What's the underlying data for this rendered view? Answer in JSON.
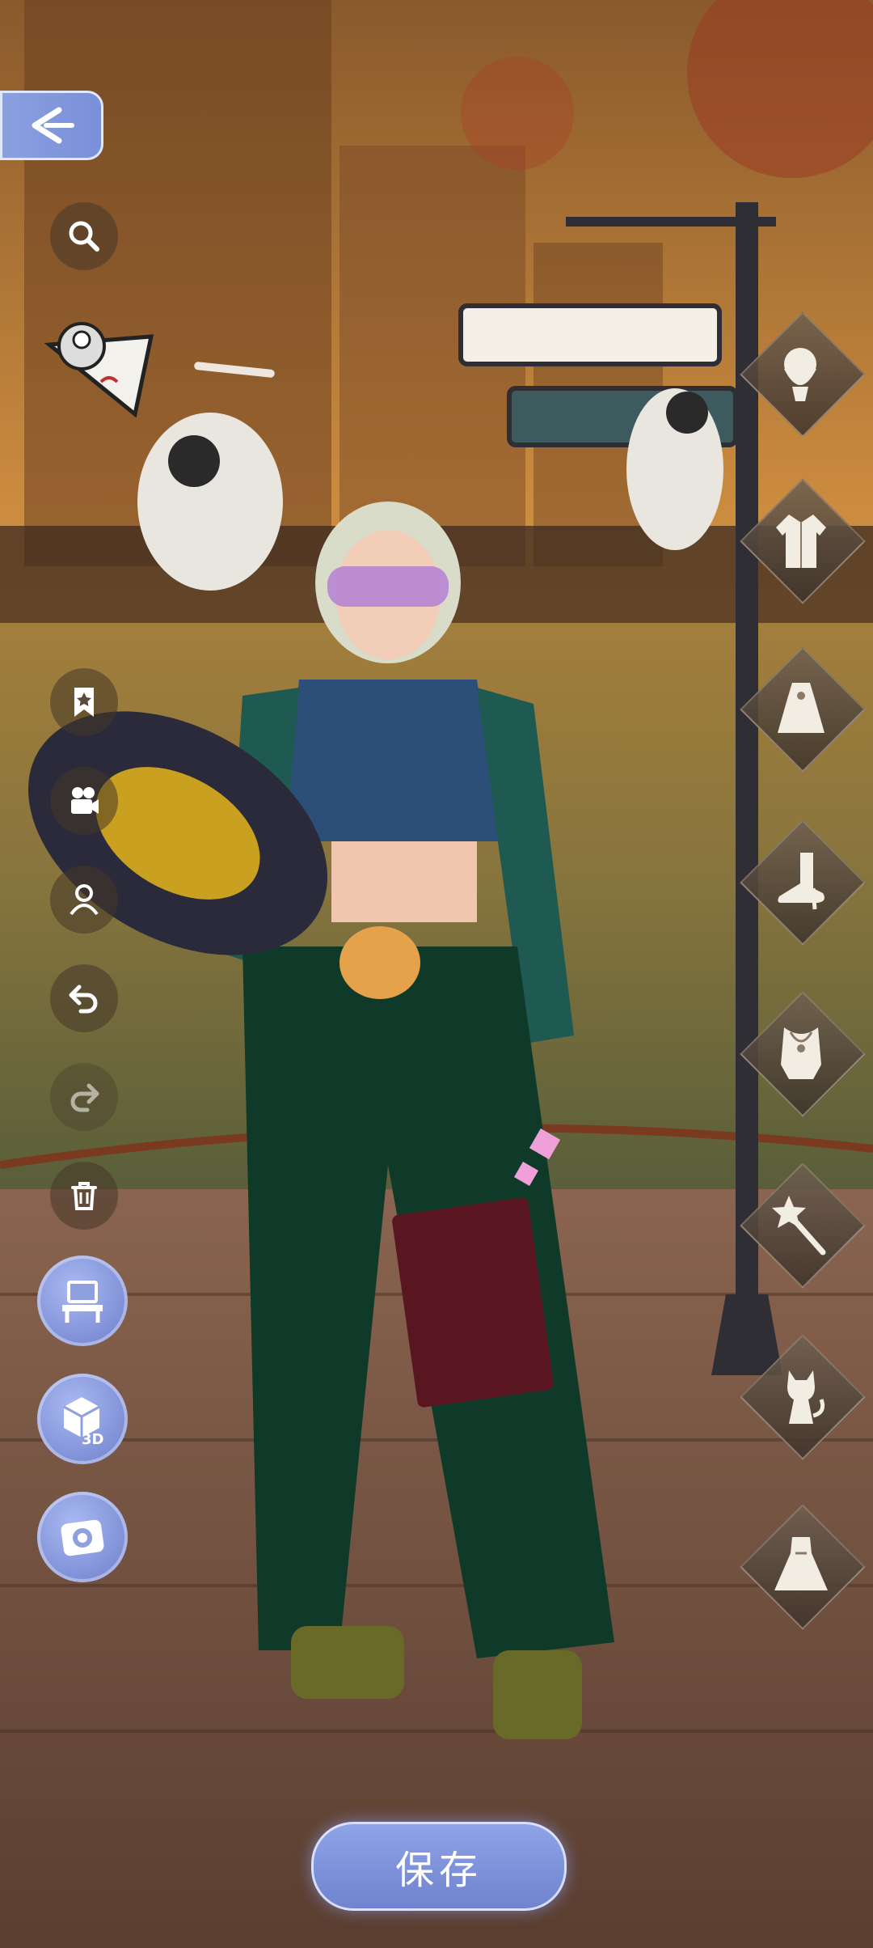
{
  "save_button": {
    "label": "保存"
  },
  "toolbar_left": [
    {
      "name": "search",
      "icon": "search-icon"
    },
    {
      "name": "favorite",
      "icon": "bookmark-star-icon"
    },
    {
      "name": "video",
      "icon": "camera-icon"
    },
    {
      "name": "pose",
      "icon": "person-icon"
    },
    {
      "name": "undo",
      "icon": "undo-icon"
    },
    {
      "name": "redo",
      "icon": "redo-icon"
    },
    {
      "name": "delete",
      "icon": "trash-icon"
    }
  ],
  "tool_buttons": [
    {
      "name": "dresser",
      "icon": "vanity-icon"
    },
    {
      "name": "view-3d",
      "icon": "cube-3d-icon",
      "label": "3D"
    },
    {
      "name": "photo",
      "icon": "photo-camera-icon"
    }
  ],
  "category_icons": [
    "hair-icon",
    "jacket-icon",
    "top-icon",
    "shoe-icon",
    "necklace-icon",
    "wand-icon",
    "cat-icon",
    "dress-icon"
  ],
  "colors": {
    "accent": "#7e8fd6",
    "save_text": "#ffffff"
  }
}
